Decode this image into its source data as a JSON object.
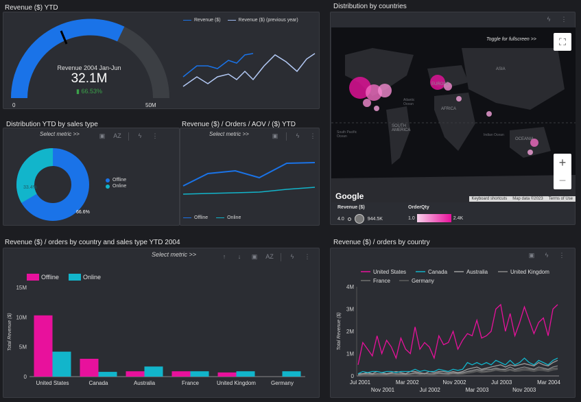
{
  "titles": {
    "revenue_ytd": "Revenue ($) YTD",
    "distribution_countries": "Distribution by countries",
    "distribution_sales_type": "Distribution YTD by sales type",
    "rev_orders_aov": "Revenue ($) / Orders / AOV / ($) YTD",
    "rev_orders_country_type": "Revenue ($) / orders by country and sales type YTD 2004",
    "rev_orders_country": "Revenue ($) / orders by country"
  },
  "select_metric": "Select metric >>",
  "gauge": {
    "label": "Revenue 2004 Jan-Jun",
    "value": "32.1M",
    "change": "66.53%",
    "min_label": "0",
    "max_label": "50M",
    "fill_fraction": 0.642,
    "colors": {
      "fill": "#1a73e8",
      "track": "#3c3f44",
      "change": "#3ca34a"
    }
  },
  "sparkline_legend": [
    "Revenue ($)",
    "Revenue ($) (previous year)"
  ],
  "donut": {
    "legend": [
      "Offline",
      "Online"
    ],
    "offline_pct": "66.6%",
    "online_pct": "33.4%",
    "offline_value": 66.6,
    "online_value": 33.4,
    "colors": {
      "offline": "#1a73e8",
      "online": "#12b5cb"
    }
  },
  "aov_legend": [
    "Offline",
    "Online"
  ],
  "map": {
    "toggle_text": "Toggle for fullscreen >>",
    "labels": [
      "ASIA",
      "EUROPE",
      "AFRICA",
      "SOUTH AMERICA",
      "Atlantic Ocean",
      "Indian Ocean",
      "South Pacific Ocean",
      "OCEANIA"
    ],
    "google": "Google",
    "footer": [
      "Keyboard shortcuts",
      "Map data ©2023",
      "Terms of Use"
    ],
    "zoom_in": "+",
    "zoom_out": "−",
    "legend": {
      "revenue_title": "Revenue ($)",
      "revenue_min": "4.0",
      "revenue_max": "944.5K",
      "qty_title": "OrderQty",
      "qty_min": "1.0",
      "qty_max": "2.4K"
    }
  },
  "chart_data": [
    {
      "type": "bar",
      "title": "Revenue ($) / orders by country and sales type YTD 2004",
      "ylabel": "Total Revenue ($)",
      "categories": [
        "United States",
        "Canada",
        "Australia",
        "France",
        "United Kingdom",
        "Germany"
      ],
      "series": [
        {
          "name": "Offline",
          "color": "#e8119c",
          "values": [
            10.3,
            3.0,
            0.9,
            0.9,
            0.7,
            0
          ]
        },
        {
          "name": "Online",
          "color": "#12b5cb",
          "values": [
            4.2,
            0.8,
            1.7,
            0.9,
            0.9,
            0.9
          ]
        }
      ],
      "yticks": [
        "0",
        "5M",
        "10M",
        "15M"
      ],
      "ylim": [
        0,
        15
      ],
      "legend_position": "top-left"
    },
    {
      "type": "line",
      "title": "Revenue ($) / orders by country",
      "ylabel": "Total Revenue ($)",
      "yticks": [
        "0",
        "1M",
        "2M",
        "3M",
        "4M"
      ],
      "ylim": [
        0,
        4
      ],
      "xticks_top": [
        "Jul 2001",
        "Mar 2002",
        "Nov 2002",
        "Jul 2003",
        "Mar 2004"
      ],
      "xticks_bottom": [
        "Nov 2001",
        "Jul 2002",
        "Mar 2003",
        "Nov 2003"
      ],
      "series": [
        {
          "name": "United States",
          "color": "#e8119c",
          "values": [
            0.5,
            1.5,
            1.2,
            0.9,
            1.8,
            1.0,
            1.6,
            1.3,
            0.8,
            1.7,
            1.2,
            1.0,
            2.2,
            1.2,
            1.5,
            1.3,
            0.8,
            1.8,
            1.4,
            1.5,
            2.0,
            1.2,
            1.6,
            1.9,
            1.8,
            2.5,
            1.7,
            1.8,
            2.0,
            3.0,
            3.2,
            2.0,
            2.8,
            1.8,
            2.4,
            3.1,
            2.5,
            1.9,
            2.4,
            2.6,
            1.8,
            3.0,
            3.2
          ]
        },
        {
          "name": "Canada",
          "color": "#12b5cb",
          "values": [
            0.1,
            0.2,
            0.15,
            0.2,
            0.2,
            0.15,
            0.2,
            0.2,
            0.15,
            0.2,
            0.2,
            0.2,
            0.3,
            0.2,
            0.25,
            0.2,
            0.2,
            0.3,
            0.25,
            0.2,
            0.3,
            0.25,
            0.3,
            0.6,
            0.5,
            0.6,
            0.5,
            0.6,
            0.5,
            0.7,
            0.6,
            0.5,
            0.7,
            0.5,
            0.6,
            0.8,
            0.6,
            0.5,
            0.7,
            0.6,
            0.5,
            0.7,
            0.8
          ]
        },
        {
          "name": "Australia",
          "color": "#9e9e9e",
          "values": [
            0.1,
            0.1,
            0.15,
            0.1,
            0.2,
            0.15,
            0.1,
            0.15,
            0.2,
            0.15,
            0.1,
            0.2,
            0.2,
            0.15,
            0.1,
            0.2,
            0.15,
            0.2,
            0.2,
            0.15,
            0.2,
            0.15,
            0.2,
            0.3,
            0.35,
            0.4,
            0.3,
            0.35,
            0.4,
            0.45,
            0.5,
            0.4,
            0.5,
            0.45,
            0.5,
            0.55,
            0.5,
            0.45,
            0.6,
            0.5,
            0.45,
            0.6,
            0.7
          ]
        },
        {
          "name": "United Kingdom",
          "color": "#8a8a8a",
          "values": [
            0.05,
            0.1,
            0.1,
            0.08,
            0.1,
            0.1,
            0.08,
            0.12,
            0.1,
            0.1,
            0.08,
            0.1,
            0.15,
            0.1,
            0.12,
            0.1,
            0.1,
            0.15,
            0.12,
            0.1,
            0.15,
            0.12,
            0.15,
            0.2,
            0.25,
            0.3,
            0.25,
            0.3,
            0.3,
            0.35,
            0.3,
            0.3,
            0.4,
            0.3,
            0.35,
            0.4,
            0.35,
            0.3,
            0.4,
            0.35,
            0.3,
            0.4,
            0.45
          ]
        },
        {
          "name": "France",
          "color": "#707070",
          "values": [
            0.05,
            0.08,
            0.08,
            0.06,
            0.1,
            0.08,
            0.07,
            0.1,
            0.08,
            0.08,
            0.07,
            0.1,
            0.12,
            0.08,
            0.1,
            0.09,
            0.08,
            0.12,
            0.1,
            0.09,
            0.12,
            0.1,
            0.12,
            0.18,
            0.2,
            0.25,
            0.2,
            0.22,
            0.25,
            0.3,
            0.28,
            0.25,
            0.3,
            0.25,
            0.28,
            0.32,
            0.3,
            0.26,
            0.32,
            0.3,
            0.26,
            0.33,
            0.35
          ]
        },
        {
          "name": "Germany",
          "color": "#5e5e5e",
          "values": [
            0.03,
            0.05,
            0.05,
            0.05,
            0.06,
            0.05,
            0.05,
            0.06,
            0.05,
            0.05,
            0.05,
            0.06,
            0.08,
            0.06,
            0.07,
            0.06,
            0.06,
            0.08,
            0.07,
            0.06,
            0.08,
            0.07,
            0.08,
            0.12,
            0.15,
            0.2,
            0.15,
            0.18,
            0.2,
            0.25,
            0.22,
            0.2,
            0.25,
            0.2,
            0.22,
            0.26,
            0.24,
            0.2,
            0.26,
            0.24,
            0.2,
            0.27,
            0.3
          ]
        }
      ],
      "legend_position": "top-left"
    }
  ]
}
